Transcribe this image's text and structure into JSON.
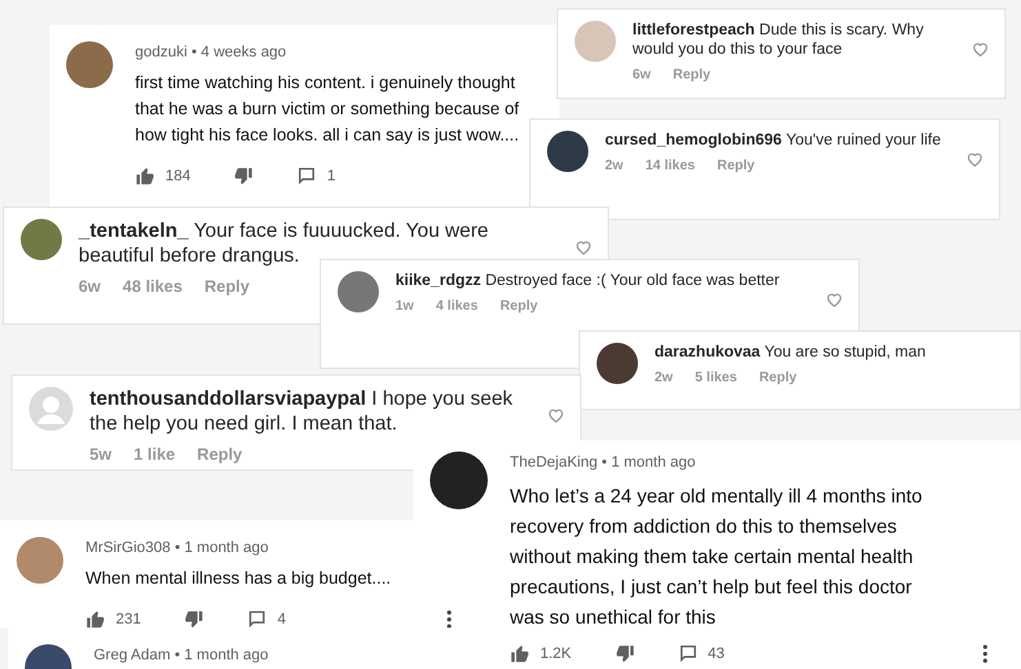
{
  "comments": [
    {
      "kind": "youtube",
      "author": "godzuki",
      "separator": "•",
      "time": "4 weeks ago",
      "text": "first time watching his content. i genuinely thought that he was a burn victim or something because of how tight his face looks. all i can say is just wow....",
      "likes": "184",
      "replies": "1",
      "menu": false
    },
    {
      "kind": "instagram",
      "author": "littleforestpeach",
      "text": "Dude this is scary. Why would you do this to your face",
      "age": "6w",
      "reply": "Reply",
      "heart": true,
      "default_avatar": false
    },
    {
      "kind": "instagram",
      "author": "cursed_hemoglobin696",
      "text": "You've ruined your life",
      "age": "2w",
      "likes": "14 likes",
      "reply": "Reply",
      "heart": true,
      "default_avatar": false
    },
    {
      "kind": "instagram",
      "author": "_tentakeln_",
      "text": "Your face is fuuuucked. You were beautiful before drangus.",
      "age": "6w",
      "likes": "48 likes",
      "reply": "Reply",
      "heart": true,
      "default_avatar": false
    },
    {
      "kind": "instagram",
      "author": "kiike_rdgzz",
      "text": "Destroyed face :( Your old face was better",
      "age": "1w",
      "likes": "4 likes",
      "reply": "Reply",
      "heart": true,
      "default_avatar": false
    },
    {
      "kind": "instagram",
      "author": "darazhukovaa",
      "text": "You are so stupid, man",
      "age": "2w",
      "likes": "5 likes",
      "reply": "Reply",
      "heart": false,
      "default_avatar": false
    },
    {
      "kind": "instagram",
      "author": "tenthousanddollarsviapaypal",
      "text": "I hope you seek the help you need girl. I mean that.",
      "age": "5w",
      "likes": "1 like",
      "reply": "Reply",
      "heart": true,
      "default_avatar": true
    },
    {
      "kind": "youtube",
      "author": "MrSirGio308",
      "separator": "•",
      "time": "1 month ago",
      "text": "When mental illness has a big budget....",
      "likes": "231",
      "replies": "4",
      "menu": true
    },
    {
      "kind": "youtube",
      "author": "Greg Adam",
      "separator": "•",
      "time": "1 month ago"
    },
    {
      "kind": "youtube",
      "author": "TheDejaKing",
      "separator": "•",
      "time": "1 month ago",
      "text": "Who let’s a 24 year old mentally ill 4 months into recovery from addiction do this to themselves without making them take certain mental health precautions, I just can’t help but feel this doctor was so unethical for this",
      "likes": "1.2K",
      "replies": "43",
      "menu": true
    }
  ]
}
